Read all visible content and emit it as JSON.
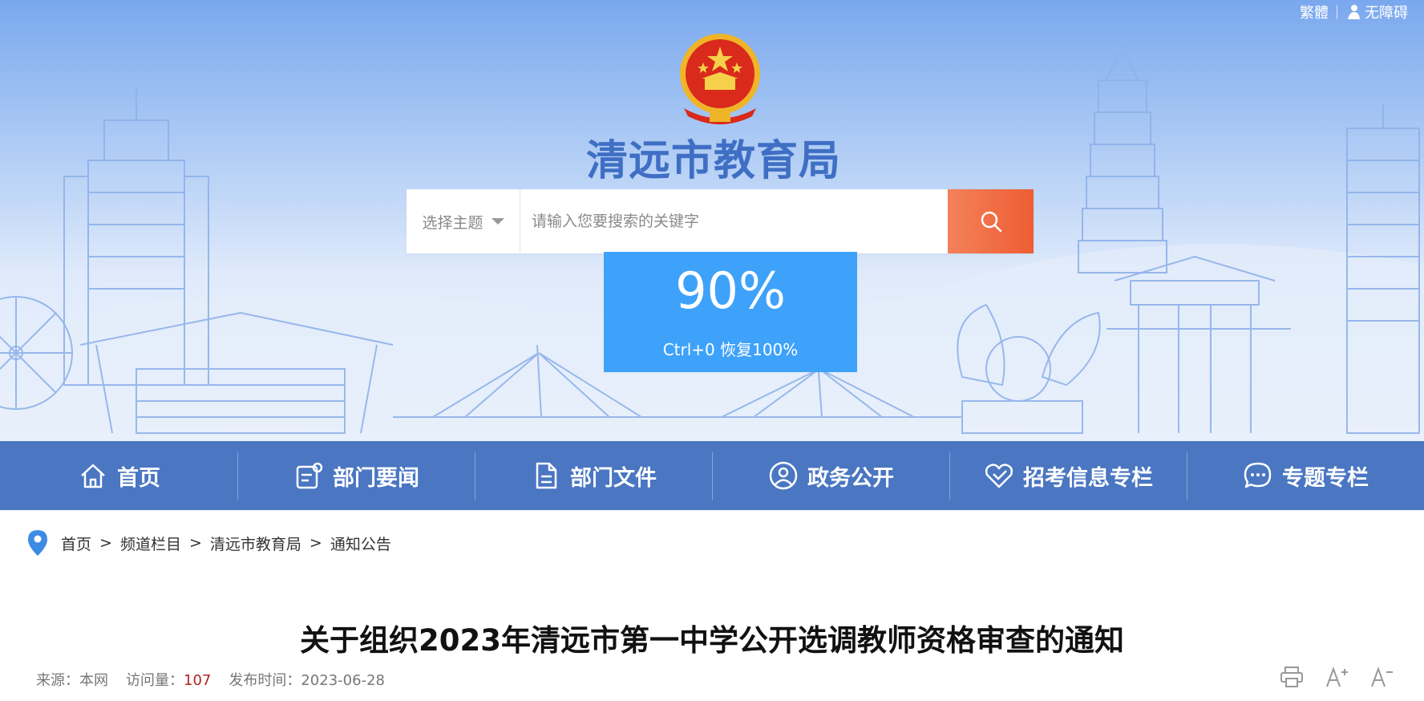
{
  "top_links": {
    "traditional": "繁體",
    "accessibility": "无障碍"
  },
  "site": {
    "title": "清远市教育局",
    "emblem_icon": "national-emblem-icon"
  },
  "search": {
    "topic_label": "选择主题",
    "placeholder": "请输入您要搜索的关键字",
    "button_icon": "search-icon"
  },
  "zoom": {
    "level": "90%",
    "hint": "Ctrl+0 恢复100%"
  },
  "nav": [
    {
      "label": "首页",
      "icon": "home-icon"
    },
    {
      "label": "部门要闻",
      "icon": "news-icon"
    },
    {
      "label": "部门文件",
      "icon": "document-icon"
    },
    {
      "label": "政务公开",
      "icon": "user-circle-icon"
    },
    {
      "label": "招考信息专栏",
      "icon": "heart-check-icon"
    },
    {
      "label": "专题专栏",
      "icon": "chat-icon"
    }
  ],
  "breadcrumb": [
    "首页",
    "频道栏目",
    "清远市教育局",
    "通知公告"
  ],
  "article": {
    "title": "关于组织2023年清远市第一中学公开选调教师资格审查的通知",
    "source_label": "来源：",
    "source": "本网",
    "views_label": "访问量：",
    "views": "107",
    "date_label": "发布时间：",
    "date": "2023-06-28"
  },
  "colors": {
    "nav_bg": "#4a76c2",
    "title_blue": "#3f6fc4",
    "search_btn": "#ee5d33",
    "zoom_popup": "#3ea2fb",
    "views_red": "#b22222"
  }
}
